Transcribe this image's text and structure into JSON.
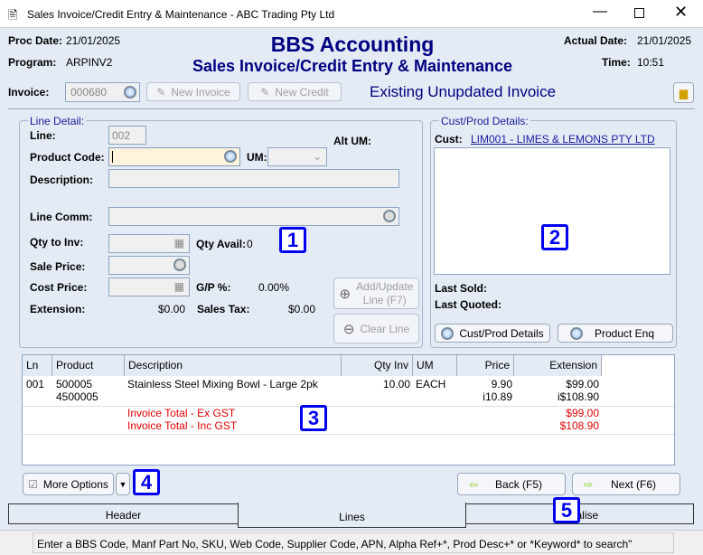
{
  "window": {
    "title": "Sales Invoice/Credit Entry & Maintenance - ABC Trading Pty Ltd",
    "icon": "app-icon"
  },
  "header": {
    "proc_date_label": "Proc Date:",
    "proc_date": "21/01/2025",
    "program_label": "Program:",
    "program": "ARPINV2",
    "app_title": "BBS Accounting",
    "subtitle": "Sales Invoice/Credit Entry & Maintenance",
    "actual_date_label": "Actual Date:",
    "actual_date": "21/01/2025",
    "time_label": "Time:",
    "time": "10:51"
  },
  "invoice": {
    "label": "Invoice:",
    "value": "000680",
    "new_invoice": "New Invoice",
    "new_credit": "New Credit",
    "status": "Existing Unupdated Invoice"
  },
  "line_detail": {
    "title": "Line Detail:",
    "line_label": "Line:",
    "line": "002",
    "product_code_label": "Product Code:",
    "product_code": "",
    "um_label": "UM:",
    "alt_um_label": "Alt UM:",
    "description_label": "Description:",
    "line_comm_label": "Line Comm:",
    "qty_label": "Qty to Inv:",
    "qty_avail_label": "Qty Avail:",
    "qty_avail": "0",
    "sale_price_label": "Sale Price:",
    "cost_price_label": "Cost Price:",
    "gp_label": "G/P %:",
    "gp": "0.00%",
    "extension_label": "Extension:",
    "extension": "$0.00",
    "sales_tax_label": "Sales Tax:",
    "sales_tax": "$0.00",
    "add_update": "Add/Update",
    "add_update2": "Line (F7)",
    "clear_line": "Clear Line"
  },
  "cust_prod": {
    "title": "Cust/Prod Details:",
    "cust_label": "Cust:",
    "cust": "LIM001 - LIMES & LEMONS PTY LTD",
    "last_sold_label": "Last Sold:",
    "last_quoted_label": "Last Quoted:",
    "details_btn": "Cust/Prod Details",
    "enq_btn": "Product Enq"
  },
  "grid": {
    "columns": [
      "Ln",
      "Product",
      "Description",
      "Qty Inv",
      "UM",
      "Price",
      "Extension"
    ],
    "rows": [
      {
        "ln": "001",
        "product": "500005",
        "product2": "4500005",
        "description": "Stainless Steel Mixing Bowl - Large 2pk",
        "qty": "10.00",
        "um": "EACH",
        "price": "9.90",
        "price2": "i10.89",
        "ext": "$99.00",
        "ext2": "i$108.90"
      }
    ],
    "totals": [
      {
        "label": "Invoice Total - Ex GST",
        "value": "$99.00"
      },
      {
        "label": "Invoice Total - Inc GST",
        "value": "$108.90"
      }
    ]
  },
  "buttons": {
    "more_options": "More Options",
    "back": "Back (F5)",
    "next": "Next (F6)"
  },
  "tabs": [
    "Header",
    "Lines",
    "Finalise"
  ],
  "status_bar": "Enter a BBS Code, Manf Part No, SKU, Web Code, Supplier Code, APN, Alpha Ref+*, Prod Desc+* or *Keyword* to search\"",
  "badges": [
    "1",
    "2",
    "3",
    "4",
    "5"
  ],
  "colors": {
    "title": "#000080",
    "total": "#e00000",
    "badge": "#0000ee"
  }
}
